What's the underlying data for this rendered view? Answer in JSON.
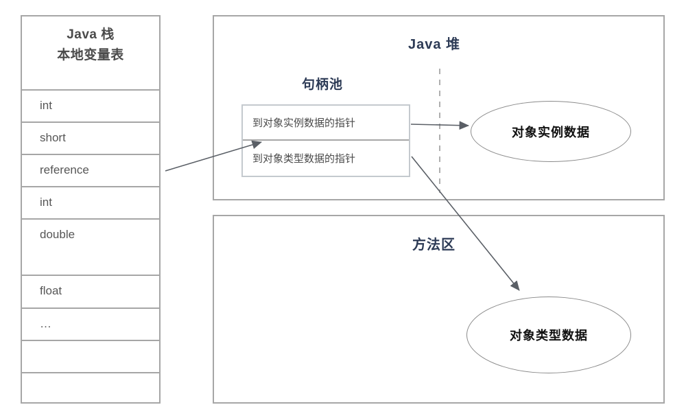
{
  "diagram": {
    "title_visible": false,
    "colors": {
      "region_border": "#a6a6a6",
      "region_title": "#2c3a55",
      "stack_text": "#565656",
      "arrow": "#5a5f66",
      "ellipse_border": "#8a8a8a",
      "handle_border": "#c4c9ce"
    }
  },
  "stack": {
    "header_line1": "Java 栈",
    "header_line2": "本地变量表",
    "rows": [
      {
        "label": "int"
      },
      {
        "label": "short"
      },
      {
        "label": "reference"
      },
      {
        "label": "int"
      },
      {
        "label": "double"
      },
      {
        "label": "float"
      },
      {
        "label": "…"
      },
      {
        "label": ""
      },
      {
        "label": ""
      }
    ]
  },
  "heap": {
    "title": "Java 堆",
    "handle_pool": {
      "title": "句柄池",
      "slots": [
        {
          "label": "到对象实例数据的指针"
        },
        {
          "label": "到对象类型数据的指针"
        }
      ]
    },
    "instance_ellipse": {
      "label": "对象实例数据"
    }
  },
  "method_area": {
    "title": "方法区",
    "type_ellipse": {
      "label": "对象类型数据"
    }
  },
  "connectors": [
    {
      "name": "reference-to-handle-pool",
      "from": "reference",
      "to": "句柄池"
    },
    {
      "name": "instance-pointer-to-instance-data",
      "from": "到对象实例数据的指针",
      "to": "对象实例数据"
    },
    {
      "name": "type-pointer-to-type-data",
      "from": "到对象类型数据的指针",
      "to": "对象类型数据"
    }
  ]
}
